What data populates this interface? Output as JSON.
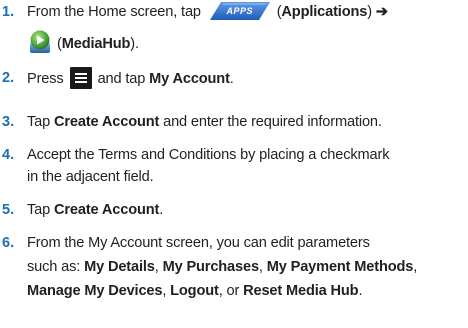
{
  "steps": [
    {
      "number": "1.",
      "t1": "From the Home screen, tap",
      "icon_apps_label": "APPS",
      "t2": "(",
      "b1": "Applications",
      "t3": ") ",
      "arrow": "➔",
      "line2_t1": "(",
      "line2_b1": "MediaHub",
      "line2_t2": ")."
    },
    {
      "number": "2.",
      "t1": "Press",
      "t2": "and tap",
      "b1": "My Account",
      "t3": "."
    },
    {
      "number": "3.",
      "t1": "Tap",
      "b1": "Create Account",
      "t2": "and enter the required information."
    },
    {
      "number": "4.",
      "t1": "Accept the Terms and Conditions by placing a checkmark",
      "line2": "in the adjacent field."
    },
    {
      "number": "5.",
      "t1": "Tap",
      "b1": "Create Account",
      "t2": "."
    },
    {
      "number": "6.",
      "t1": "From the My Account screen, you can edit parameters",
      "line2_t1": "such as:",
      "line2_b1": "My Details",
      "line2_t2": ",",
      "line2_b2": "My Purchases",
      "line2_t3": ",",
      "line2_b3": "My Payment Methods",
      "line2_t4": ",",
      "line3_b1": "Manage My Devices",
      "line3_t1": ",",
      "line3_b2": "Logout",
      "line3_t2": ", or",
      "line3_b3": "Reset Media Hub",
      "line3_t3": "."
    }
  ],
  "icons": {
    "apps": "apps-icon",
    "mediahub": "mediahub-icon",
    "menu": "menu-key-icon"
  },
  "colors": {
    "step_number": "#1a6fb5",
    "text": "#231f20",
    "apps_icon": "#2e6fd0",
    "menu_icon_bg": "#1a1a1a"
  }
}
